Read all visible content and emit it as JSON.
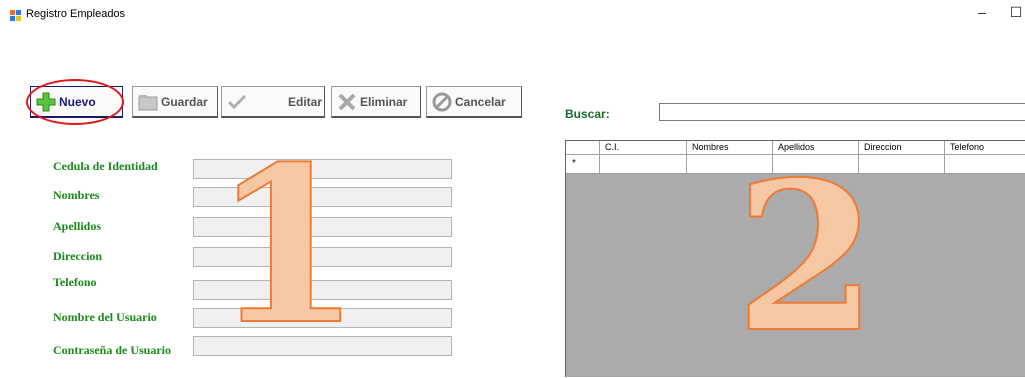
{
  "window": {
    "title": "Registro Empleados",
    "controls": [
      "–",
      "☐"
    ]
  },
  "toolbar": {
    "nuevo": "Nuevo",
    "guardar": "Guardar",
    "editar": "Editar",
    "eliminar": "Eliminar",
    "cancelar": "Cancelar"
  },
  "form": {
    "cedula": "Cedula de Identidad",
    "nombres": "Nombres",
    "apellidos": "Apellidos",
    "direccion": "Direccion",
    "telefono": "Telefono",
    "usuario": "Nombre del Usuario",
    "contrasena": "Contraseña de Usuario"
  },
  "search": {
    "label": "Buscar:",
    "value": ""
  },
  "grid": {
    "columns": [
      "C.I.",
      "Nombres",
      "Apellidos",
      "Direccion",
      "Telefono"
    ],
    "new_row_marker": "*"
  },
  "overlay": {
    "one": "1",
    "two": "2"
  },
  "colors": {
    "label_green": "#1a8a1a",
    "highlight_red": "#e01a1a",
    "overlay_orange": "#ee7a35",
    "grid_bg": "#ababab"
  }
}
